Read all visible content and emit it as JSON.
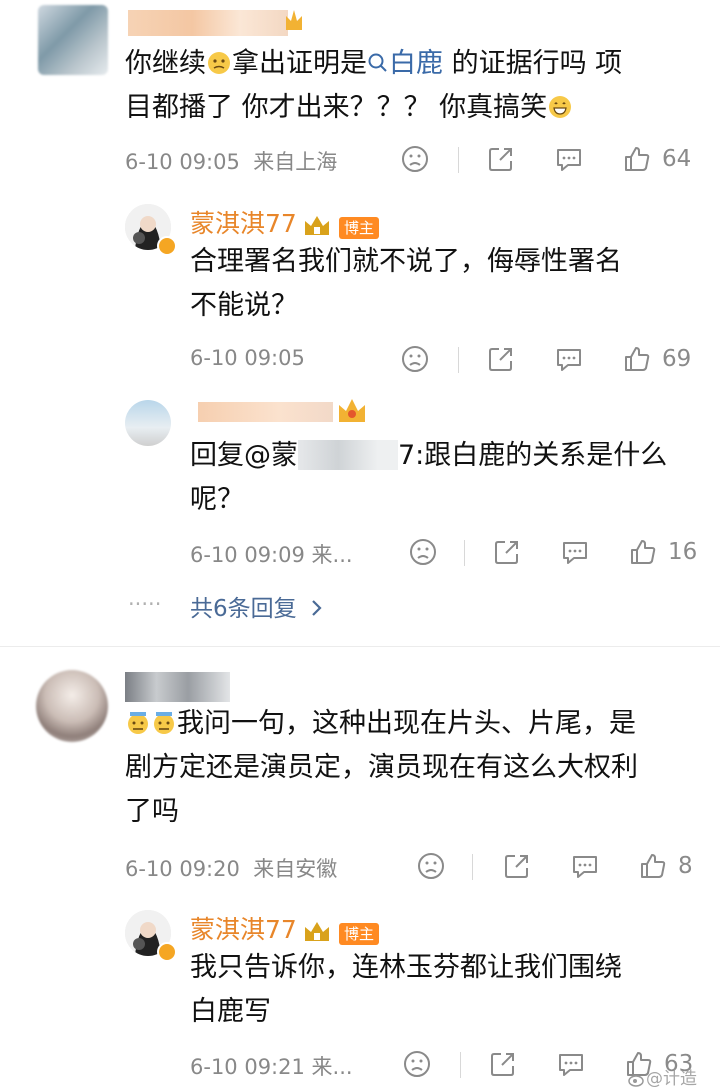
{
  "comments": [
    {
      "text_lines": [
        "你继续",
        "拿出证明是",
        "白鹿",
        " 的证据行吗 项",
        "目都播了 你才出来？？？ 你真搞笑"
      ],
      "time": "6-10 09:05",
      "location": "来自上海",
      "likes": "64",
      "replies": [
        {
          "username": "蒙淇淇77",
          "badge": "博主",
          "text_lines": [
            "合理署名我们就不说了，侮辱性署名",
            "不能说？"
          ],
          "time": "6-10 09:05",
          "likes": "69"
        },
        {
          "text_lines": [
            "回复@蒙",
            "7:跟白鹿的关系是什么",
            "呢？"
          ],
          "time": "6-10 09:09",
          "source": "来...",
          "likes": "16"
        }
      ],
      "more_replies": "共6条回复"
    },
    {
      "text_lines": [
        "我问一句，这种出现在片头、片尾，是",
        "剧方定还是演员定，演员现在有这么大权利",
        "了吗"
      ],
      "time": "6-10 09:20",
      "location": "来自安徽",
      "likes": "8",
      "replies": [
        {
          "username": "蒙淇淇77",
          "badge": "博主",
          "text_lines": [
            "我只告诉你，连林玉芬都让我们围绕",
            "白鹿写"
          ],
          "time": "6-10 09:21",
          "source": "来...",
          "likes": "63"
        }
      ]
    }
  ],
  "dots": "·····",
  "watermark": "@计造",
  "colors": {
    "accent": "#e8862a",
    "link": "#3a6aa8",
    "badge": "#ff8a22"
  }
}
